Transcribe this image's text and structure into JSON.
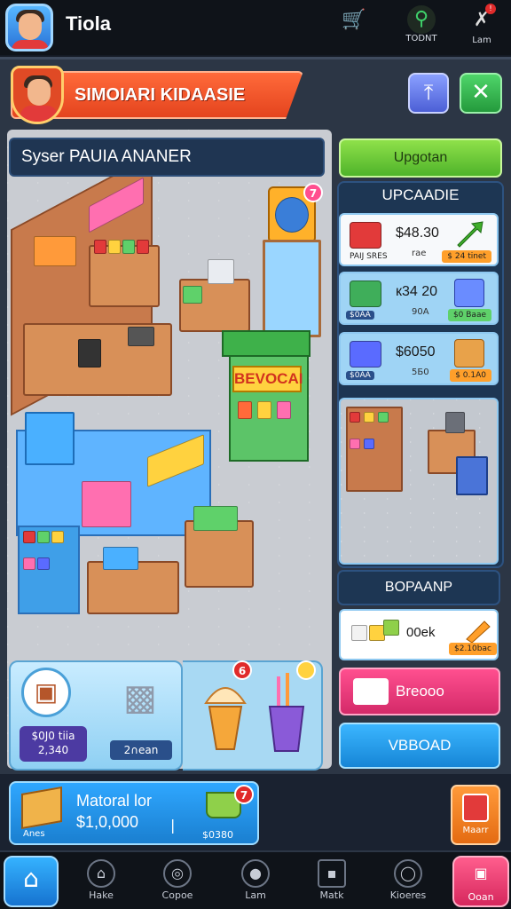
{
  "header": {
    "app_title": "Tiola",
    "cart_label": "",
    "search_label": "TODNT",
    "tools_label": "Lam",
    "tools_badge": "!"
  },
  "banner": {
    "title": "SIMOIARI KIDAASIE"
  },
  "store": {
    "label": "Syser PAUIA ANANER",
    "kiosk_sign": "BEVOCAI",
    "sign_badge": "7"
  },
  "popups": {
    "supply_top": "$0J0 tiia",
    "supply_bottom": "2,340",
    "tag": "2∩ean",
    "icecream_badge": "6",
    "drink_badge": ""
  },
  "upgrade": {
    "top_button": "Upgotan",
    "title": "UPCAADIE",
    "cards": [
      {
        "price": "$48.30",
        "sub": "rae",
        "left_tag": "PAIJ SRES",
        "right_tag": "$ 24 tinet",
        "icon_color": "#e23a3a",
        "thumb_color": "#3fae2a"
      },
      {
        "price": "к34 20",
        "sub": "90А",
        "left_tag": "$0АА",
        "right_tag": "$0 Baae",
        "icon_color": "#3fae5a",
        "thumb_color": "#6a8cff"
      },
      {
        "price": "$6050",
        "sub": "5Б0",
        "left_tag": "$0АА",
        "right_tag": "$ 0.1А0",
        "icon_color": "#5a6bff",
        "thumb_color": "#e8a24a"
      }
    ]
  },
  "boost": {
    "title": "BOPAANP",
    "label": "00ek",
    "tag": "$2.10bac"
  },
  "buttons": {
    "pink": "Breooo",
    "blue": "VBBOAD"
  },
  "resource": {
    "title": "Matoral lor",
    "value": "$1,0,000",
    "separator": "|",
    "box_label": "Anes",
    "basket_label": "$0380",
    "basket_badge": "7",
    "side_label": "Maarr"
  },
  "nav": [
    {
      "label": "",
      "icon": "home-icon"
    },
    {
      "label": "Hake",
      "icon": "house-icon"
    },
    {
      "label": "Copoe",
      "icon": "compass-icon"
    },
    {
      "label": "Lam",
      "icon": "circle-icon"
    },
    {
      "label": "Matk",
      "icon": "bag-icon"
    },
    {
      "label": "Kioeres",
      "icon": "globe-icon"
    },
    {
      "label": "Ooan",
      "icon": "shop-icon"
    }
  ],
  "colors": {
    "accent_orange": "#e4441e",
    "accent_green": "#4fb32a",
    "panel_blue": "#1d3653",
    "button_pink": "#d42a69",
    "button_blue": "#1685d6"
  }
}
